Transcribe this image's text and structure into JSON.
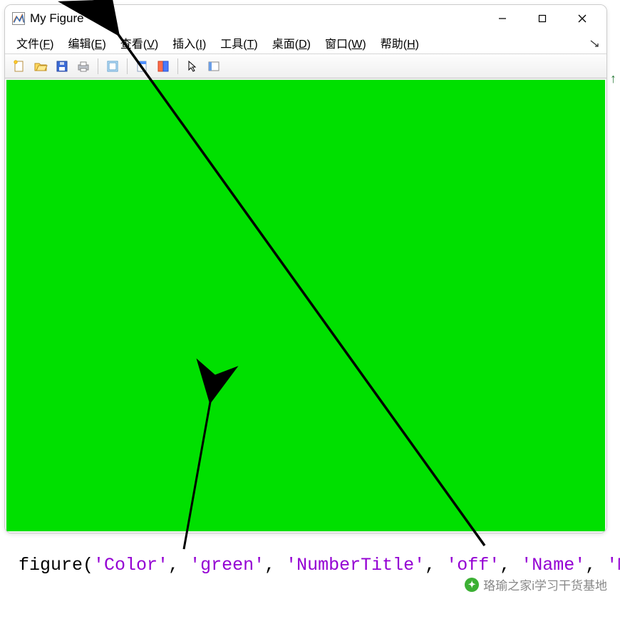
{
  "window": {
    "title": "My Figure",
    "controls": {
      "minimize": "minimize",
      "maximize": "maximize",
      "close": "close"
    }
  },
  "menu": {
    "items": [
      {
        "label": "文件",
        "hotkey": "F"
      },
      {
        "label": "编辑",
        "hotkey": "E"
      },
      {
        "label": "查看",
        "hotkey": "V"
      },
      {
        "label": "插入",
        "hotkey": "I"
      },
      {
        "label": "工具",
        "hotkey": "T"
      },
      {
        "label": "桌面",
        "hotkey": "D"
      },
      {
        "label": "窗口",
        "hotkey": "W"
      },
      {
        "label": "帮助",
        "hotkey": "H"
      }
    ]
  },
  "toolbar": {
    "items": [
      "new-figure",
      "open",
      "save",
      "print",
      "|",
      "print-preview",
      "|",
      "link-brush",
      "data-cursor",
      "|",
      "pointer",
      "insert-colorbar"
    ]
  },
  "figure": {
    "background_color": "#00e000"
  },
  "code": {
    "fn": "figure",
    "args": [
      {
        "k": "'Color'",
        "v": "'green'"
      },
      {
        "k": "'NumberTitle'",
        "v": "'off'"
      },
      {
        "k": "'Name'",
        "v": "'My Figure'"
      }
    ]
  },
  "watermark": "珞瑜之家i学习干货基地"
}
